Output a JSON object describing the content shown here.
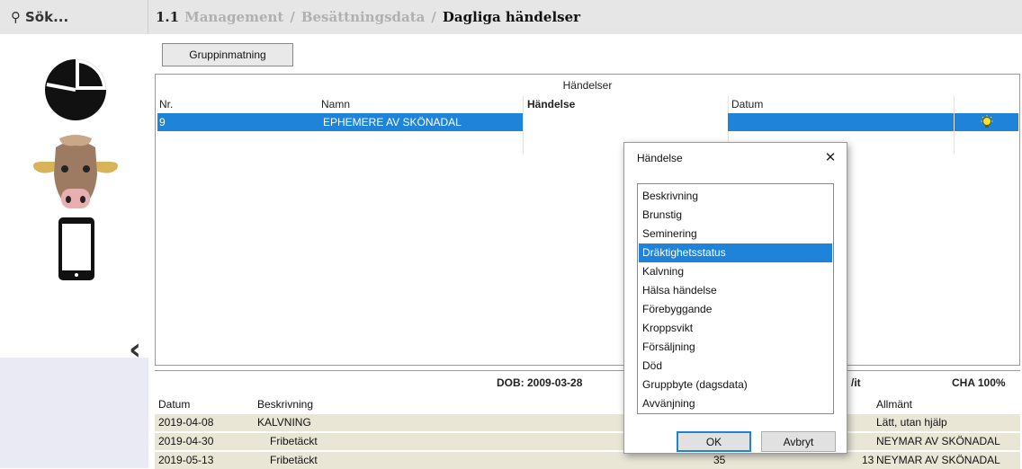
{
  "search": {
    "label": "Sök..."
  },
  "header": {
    "number": "1.1",
    "crumbs": [
      "Management",
      "Besättningsdata"
    ],
    "current": "Dagliga händelser"
  },
  "toolbar": {
    "group_input_label": "Gruppinmatning"
  },
  "events_table": {
    "title": "Händelser",
    "columns": [
      "Nr.",
      "Namn",
      "Händelse",
      "Datum"
    ],
    "selected_row": {
      "nr": "9",
      "namn": "EPHEMERE AV SKÖNADAL",
      "handelse": "",
      "datum": ""
    }
  },
  "details": {
    "dob": "DOB: 2009-03-28",
    "partial_header": "/it",
    "cha": "CHA 100%",
    "columns": {
      "datum": "Datum",
      "beskrivning": "Beskrivning",
      "allmant": "Allmänt"
    },
    "rows": [
      {
        "datum": "2019-04-08",
        "beskrivning": "KALVNING",
        "num": "",
        "num2": "",
        "allmant": "Lätt, utan hjälp"
      },
      {
        "datum": "2019-04-30",
        "beskrivning": "Fribetäckt",
        "num": "",
        "num2": "",
        "allmant": "NEYMAR AV SKÖNADAL"
      },
      {
        "datum": "2019-05-13",
        "beskrivning": "Fribetäckt",
        "num": "35",
        "num2": "13",
        "allmant": "NEYMAR AV SKÖNADAL"
      }
    ]
  },
  "dialog": {
    "title": "Händelse",
    "close_label": "✕",
    "items": [
      "Beskrivning",
      "Brunstig",
      "Seminering",
      "Dräktighetsstatus",
      "Kalvning",
      "Hälsa händelse",
      "Förebyggande",
      "Kroppsvikt",
      "Försäljning",
      "Död",
      "Gruppbyte (dagsdata)",
      "Avvänjning"
    ],
    "selected_index": 3,
    "ok_label": "OK",
    "cancel_label": "Avbryt"
  },
  "colors": {
    "selection": "#1e83d9",
    "row_bg": "#e9e6d6",
    "header_bg": "#e6e6e6"
  }
}
